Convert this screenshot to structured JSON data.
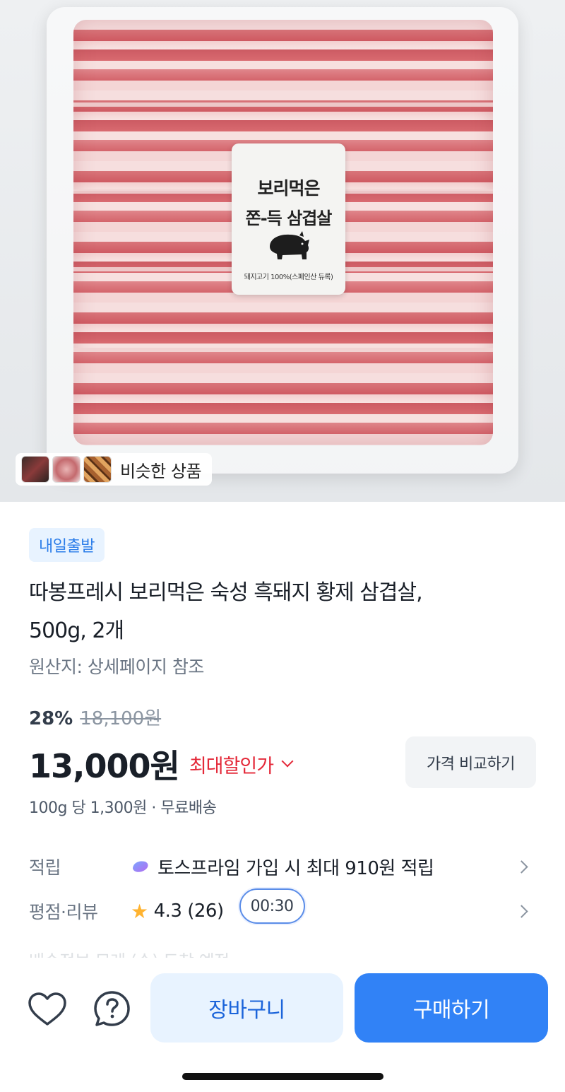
{
  "hero": {
    "label_line1": "보리먹은",
    "label_line2": "쫀-득 삼겹살",
    "label_foot": "돼지고기 100%(스페인산 듀록)",
    "similar_label": "비슷한 상품"
  },
  "product": {
    "badge": "내일출발",
    "title_line1": "따봉프레시 보리먹은 숙성 흑돼지 황제 삼겹살,",
    "title_line2": "500g, 2개",
    "origin": "원산지: 상세페이지 참조",
    "discount_pct": "28%",
    "original_price": "18,100원",
    "price": "13,000원",
    "price_tag": "최대할인가",
    "compare_button": "가격 비교하기",
    "unit_shipping": "100g 당 1,300원 · 무료배송"
  },
  "info": {
    "points_label": "적립",
    "points_value": "토스프라임 가입 시 최대 910원 적립",
    "rating_label": "평점·리뷰",
    "rating_value": "4.3 (26)",
    "timer": "00:30",
    "peek_text": "배송정보    모레 (수) 도착 예정"
  },
  "bottom": {
    "cart": "장바구니",
    "buy": "구매하기"
  },
  "colors": {
    "accent": "#3182f6",
    "red": "#e42939",
    "badge_bg": "#e8f3ff"
  }
}
